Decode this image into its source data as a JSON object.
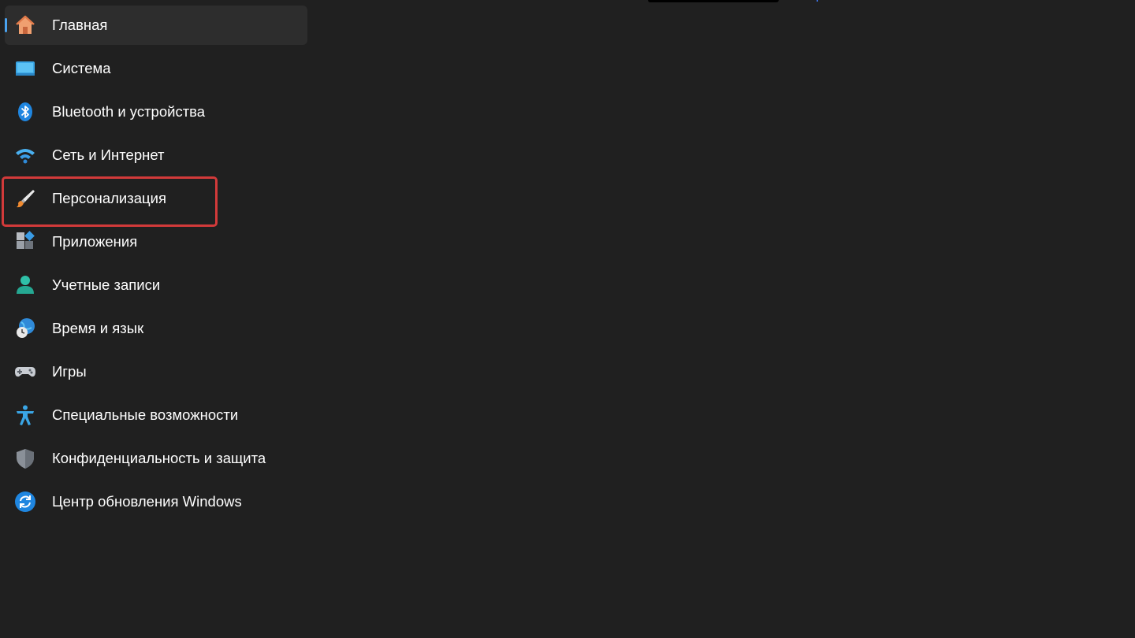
{
  "nav": {
    "items": [
      {
        "label": "Главная",
        "icon": "home-icon",
        "active": true
      },
      {
        "label": "Система",
        "icon": "system-display-icon"
      },
      {
        "label": "Bluetooth и устройства",
        "icon": "bluetooth-icon"
      },
      {
        "label": "Сеть и Интернет",
        "icon": "wifi-icon"
      },
      {
        "label": "Персонализация",
        "icon": "paintbrush-icon",
        "highlighted": true
      },
      {
        "label": "Приложения",
        "icon": "apps-icon"
      },
      {
        "label": "Учетные записи",
        "icon": "user-account-icon"
      },
      {
        "label": "Время и язык",
        "icon": "time-language-icon"
      },
      {
        "label": "Игры",
        "icon": "gamepad-icon"
      },
      {
        "label": "Специальные возможности",
        "icon": "accessibility-icon"
      },
      {
        "label": "Конфиденциальность и защита",
        "icon": "shield-icon"
      },
      {
        "label": "Центр обновления Windows",
        "icon": "windows-update-icon"
      }
    ]
  },
  "colors": {
    "background": "#202020",
    "active_item": "#2d2d2d",
    "accent": "#4aa3f0",
    "highlight_border": "#d23a3a"
  }
}
